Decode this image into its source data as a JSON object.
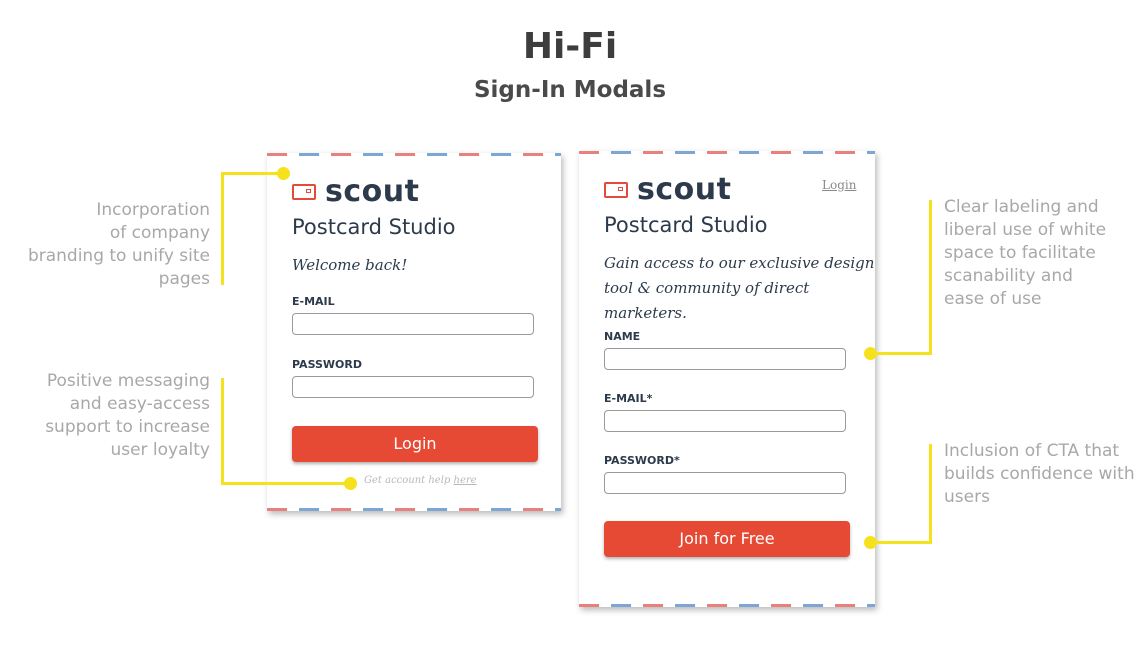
{
  "header": {
    "title": "Hi-Fi",
    "subtitle": "Sign-In Modals"
  },
  "login_modal": {
    "logo_text": "scout",
    "studio_title": "Postcard Studio",
    "welcome": "Welcome back!",
    "email_label": "E-MAIL",
    "password_label": "PASSWORD",
    "login_button": "Login",
    "help_prefix": "Get account help",
    "help_link": "here"
  },
  "signup_modal": {
    "logo_text": "scout",
    "login_link": "Login",
    "studio_title": "Postcard Studio",
    "lead_line1": "Gain access to our exclusive design",
    "lead_line2": "tool & community of direct marketers.",
    "name_label": "NAME",
    "email_label": "E-MAIL*",
    "password_label": "PASSWORD*",
    "join_button": "Join for Free"
  },
  "annotations": {
    "branding": [
      "Incorporation",
      "of company",
      "branding to unify site",
      "pages"
    ],
    "messaging": [
      "Positive messaging",
      "and easy-access",
      "support to increase",
      "user loyalty"
    ],
    "labeling": [
      "Clear labeling and",
      "liberal use of white",
      "space to facilitate",
      "scanability and",
      "ease of use"
    ],
    "cta": [
      "Inclusion of CTA that",
      "builds confidence with",
      "users"
    ]
  },
  "colors": {
    "accent": "#e64a35",
    "navy": "#2c3a4b",
    "annotation_line": "#f5e21c",
    "annotation_text": "#a8a8a8"
  },
  "icons": {
    "logo": "postcard-icon"
  }
}
